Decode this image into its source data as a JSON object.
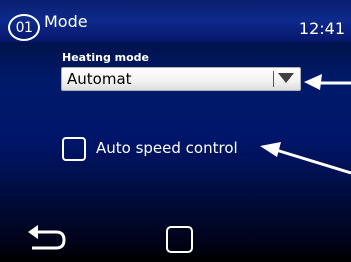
{
  "header": {
    "page_number": "01",
    "title": "Mode",
    "time": "12:41"
  },
  "heating_mode": {
    "label": "Heating mode",
    "value": "Automat"
  },
  "auto_speed_control": {
    "label": "Auto speed control",
    "checked": false
  },
  "colors": {
    "background": "#00156a",
    "header": "#0d2a8c",
    "text": "#ffffff",
    "annotation": "#ffffff"
  },
  "icons": {
    "back": "back-arrow-icon",
    "home": "home-square-icon",
    "dropdown": "triangle-down-icon"
  }
}
